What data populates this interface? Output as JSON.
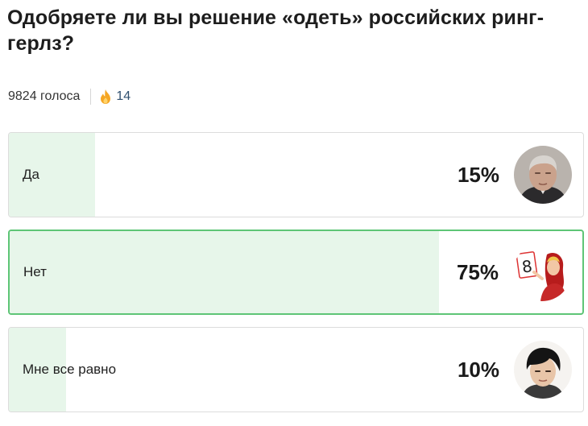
{
  "poll": {
    "question": "Одобряете ли вы решение «одеть» российских ринг-герлз?",
    "votes_text": "9824 голоса",
    "fire_icon": "fire-icon",
    "fire_count": "14",
    "colors": {
      "fill": "#e7f6ea",
      "selected_border": "#5ec576",
      "border": "#dcdcdc"
    },
    "options": [
      {
        "label": "Да",
        "percent_text": "15%",
        "percent": 15,
        "avatar": "man-portrait-avatar",
        "selected": false
      },
      {
        "label": "Нет",
        "percent_text": "75%",
        "percent": 75,
        "avatar": "ring-girl-avatar",
        "selected": true
      },
      {
        "label": "Мне все равно",
        "percent_text": "10%",
        "percent": 10,
        "avatar": "young-man-avatar",
        "selected": false
      }
    ]
  }
}
